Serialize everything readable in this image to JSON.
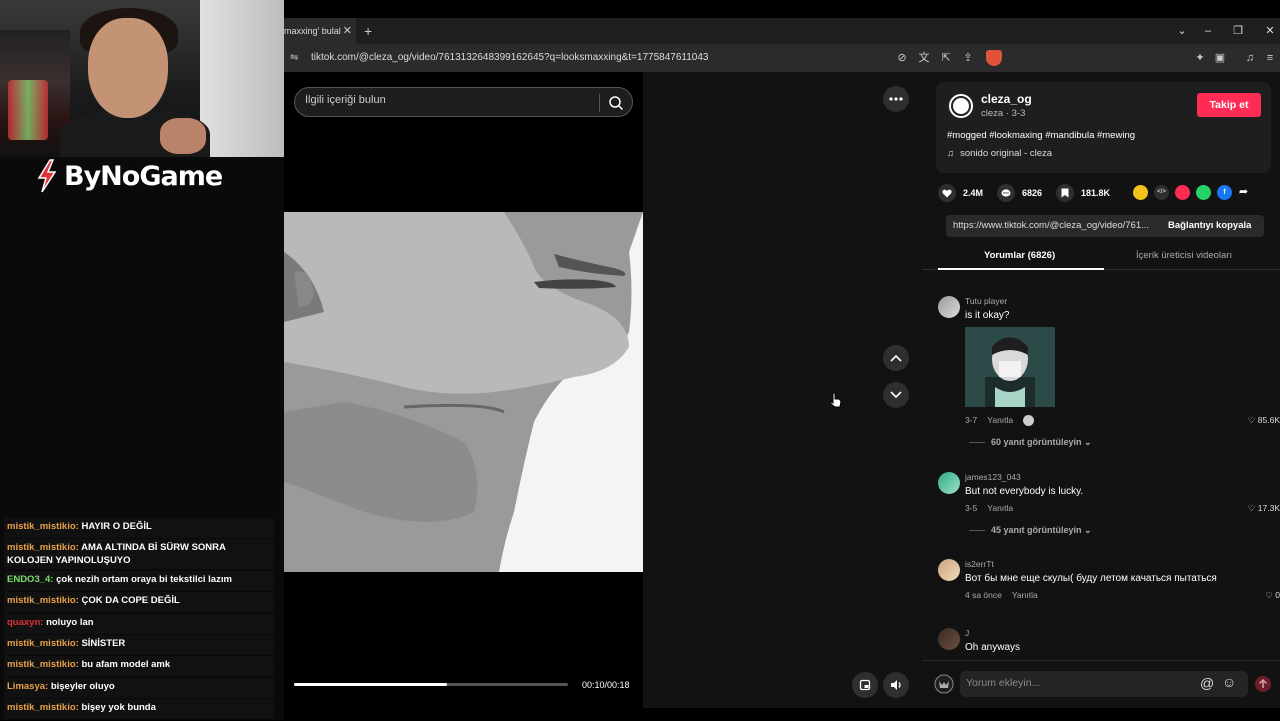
{
  "stream": {
    "brand": "ByNoGame",
    "chat": [
      {
        "user": "mistik_mistikio:",
        "color": "#e9a24a",
        "text": "HAYIR O DEĞİL"
      },
      {
        "user": "mistik_mistikio:",
        "color": "#e9a24a",
        "text": "AMA ALTINDA Bİ SÜRW SONRA KOLOJEN YAPINOLUŞUYO"
      },
      {
        "user": "ENDO3_4:",
        "color": "#7be06a",
        "text": "çok nezih ortam oraya bi tekstilci lazım"
      },
      {
        "user": "mistik_mistikio:",
        "color": "#e9a24a",
        "text": "ÇOK DA COPE DEĞİL"
      },
      {
        "user": "quaxyn:",
        "color": "#e0303a",
        "text": "noluyo lan"
      },
      {
        "user": "mistik_mistikio:",
        "color": "#e9a24a",
        "text": "SİNİSTER"
      },
      {
        "user": "mistik_mistikio:",
        "color": "#e9a24a",
        "text": "bu afam model amk"
      },
      {
        "user": "Limasya:",
        "color": "#e9a24a",
        "text": "bişeyler oluyo"
      },
      {
        "user": "mistik_mistikio:",
        "color": "#e9a24a",
        "text": "bişey yok bunda"
      }
    ]
  },
  "browser": {
    "tab_title": "maxxing' bulal",
    "url": "tiktok.com/@cleza_og/video/7613132648399162645?q=looksmaxxing&t=1775847611043"
  },
  "tiktok": {
    "search_placeholder": "İlgili içeriği bulun",
    "progress": 0.56,
    "time": "00:10/00:18",
    "creator": {
      "username": "cleza_og",
      "subline": "cleza · 3-3",
      "follow_label": "Takip et",
      "caption": "#mogged #lookmaxing #mandibula #mewing",
      "music": "sonido original - cleza"
    },
    "actions": {
      "likes": "2.4M",
      "comments": "6826",
      "saves": "181.8K"
    },
    "share_colors": [
      "#f4c21a",
      "#2f2f2f",
      "#fe2c55",
      "#25d366",
      "#1877f2"
    ],
    "link": {
      "url": "https://www.tiktok.com/@cleza_og/video/761...",
      "copy_label": "Bağlantıyı kopyala"
    },
    "tabs": {
      "comments": "Yorumlar (6826)",
      "creator_videos": "İçerik üreticisi videoları"
    },
    "reply_label": "Yanıtla",
    "comments": [
      {
        "user": "Tutu player",
        "text": "is it okay?",
        "date": "3-7",
        "likes": "85.6K",
        "replies": "60 yanıt görüntüleyin"
      },
      {
        "user": "james123_043",
        "text": "But not everybody is lucky.",
        "date": "3-5",
        "likes": "17.3K",
        "replies": "45 yanıt görüntüleyin"
      },
      {
        "user": "is2errTt",
        "text": "Вот бы мне еще скулы( буду летом качаться пытаться",
        "date": "4 sa önce",
        "likes": "0"
      },
      {
        "user": "J",
        "text": "Oh anyways"
      }
    ],
    "comment_placeholder": "Yorum ekleyin..."
  }
}
